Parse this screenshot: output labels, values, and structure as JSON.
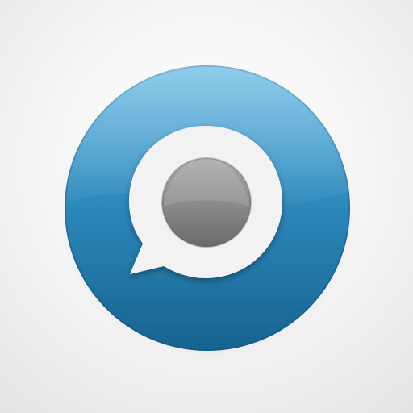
{
  "app_icon": {
    "icon": "speech-bubble-icon",
    "colors": {
      "circle_top": "#5ab3e2",
      "circle_mid": "#2a86b8",
      "circle_bottom": "#17628f",
      "bubble": "#f2f2f2",
      "lens_light": "#a8a8a8",
      "lens_dark": "#6a6a6a"
    }
  }
}
